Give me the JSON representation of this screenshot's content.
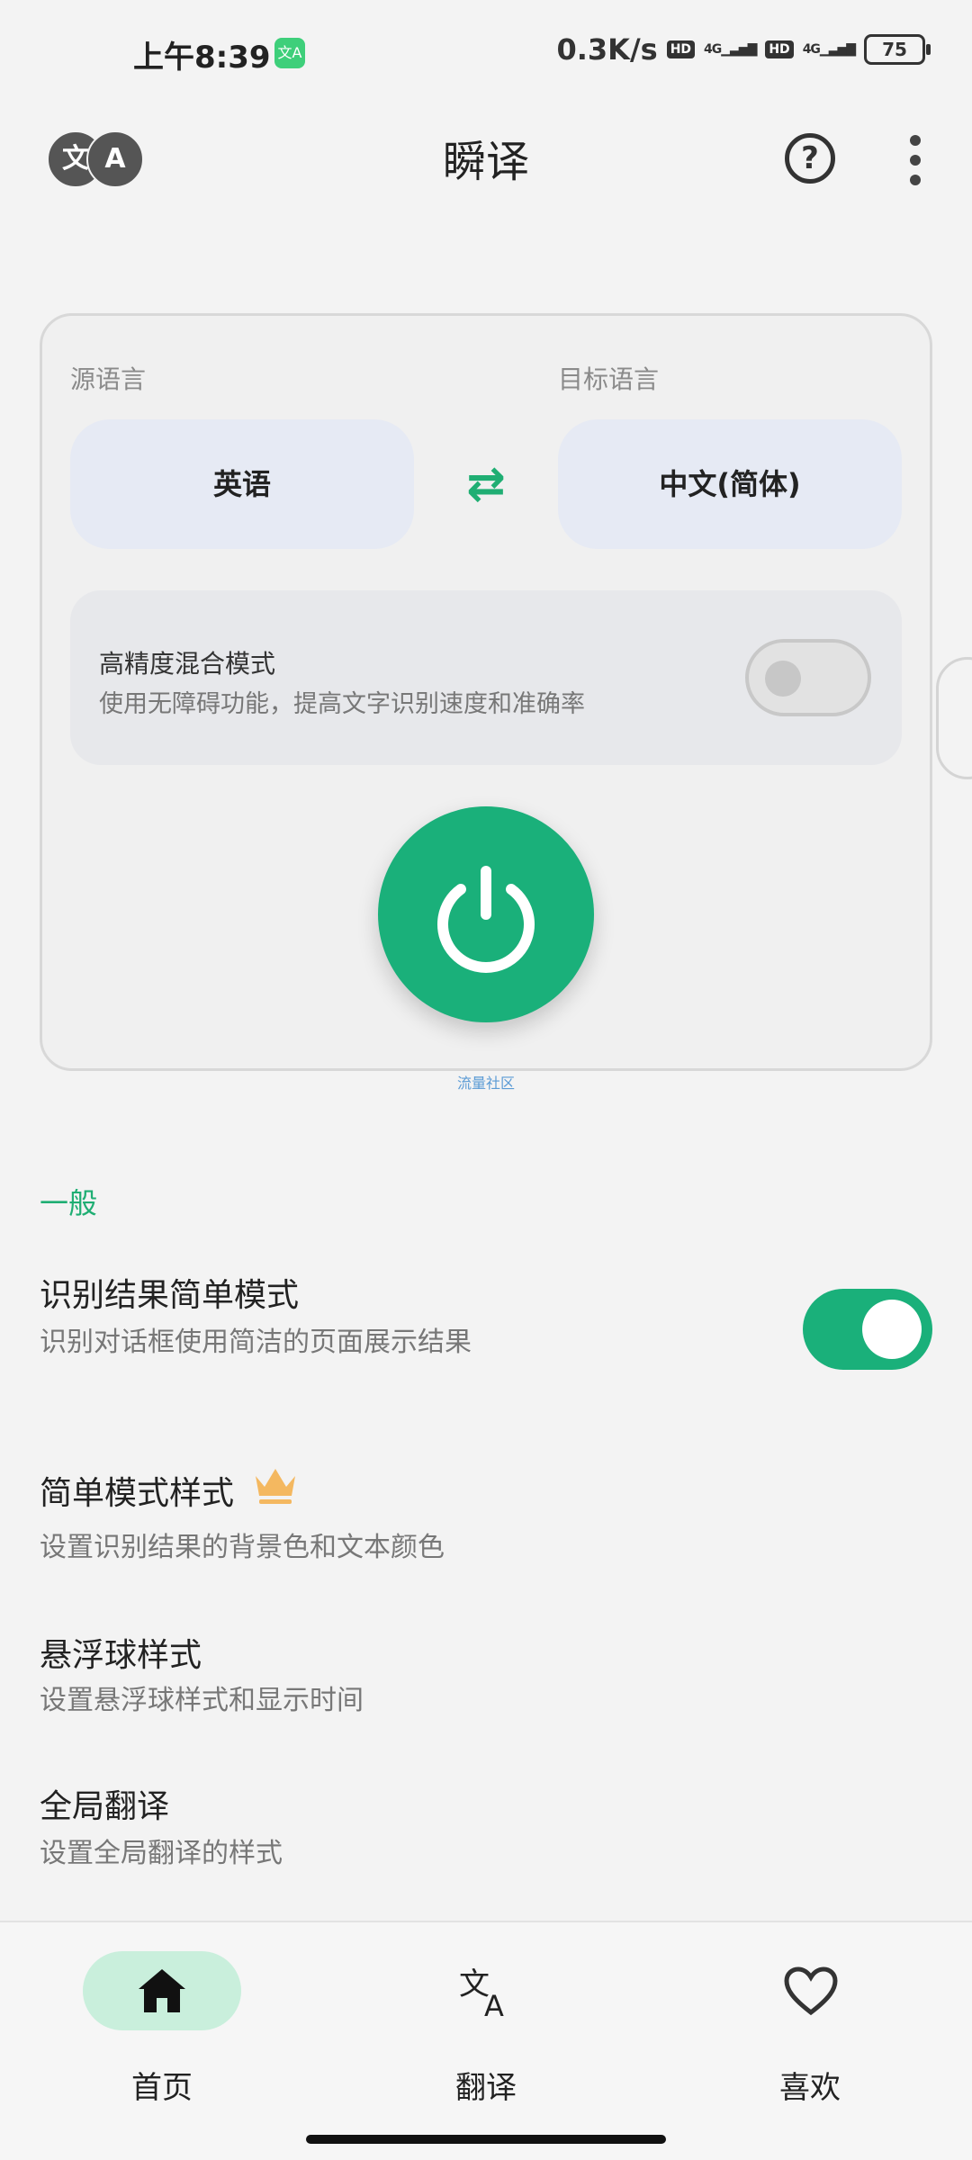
{
  "status_bar": {
    "time": "上午8:39",
    "app_icon_text": "文A",
    "speed": "0.3K/s",
    "hd1": "HD",
    "net1": "4G",
    "hd2": "HD",
    "net2": "4G",
    "battery": "75"
  },
  "app_bar": {
    "badge_left": "文",
    "badge_right": "A",
    "title": "瞬译",
    "help_icon": "?"
  },
  "translator": {
    "source_label": "源语言",
    "target_label": "目标语言",
    "source_lang": "英语",
    "target_lang": "中文(简体)",
    "swap_icon": "⇄",
    "hybrid_title": "高精度混合模式",
    "hybrid_desc": "使用无障碍功能，提高文字识别速度和准确率",
    "hybrid_enabled": false,
    "watermark": "流量社区"
  },
  "settings": {
    "section": "一般",
    "items": [
      {
        "title": "识别结果简单模式",
        "desc": "识别对话框使用简洁的页面展示结果",
        "toggle": true
      },
      {
        "title": "简单模式样式",
        "desc": "设置识别结果的背景色和文本颜色",
        "premium": true
      },
      {
        "title": "悬浮球样式",
        "desc": "设置悬浮球样式和显示时间"
      },
      {
        "title": "全局翻译",
        "desc": "设置全局翻译的样式"
      }
    ]
  },
  "bottom_nav": {
    "items": [
      {
        "label": "首页",
        "icon": "home-icon",
        "active": true
      },
      {
        "label": "翻译",
        "icon": "translate-icon",
        "active": false
      },
      {
        "label": "喜欢",
        "icon": "heart-icon",
        "active": false
      }
    ]
  },
  "colors": {
    "accent": "#1ab07a",
    "nav_active_bg": "#c9efdc",
    "lang_btn_bg": "#e6eaf4"
  }
}
